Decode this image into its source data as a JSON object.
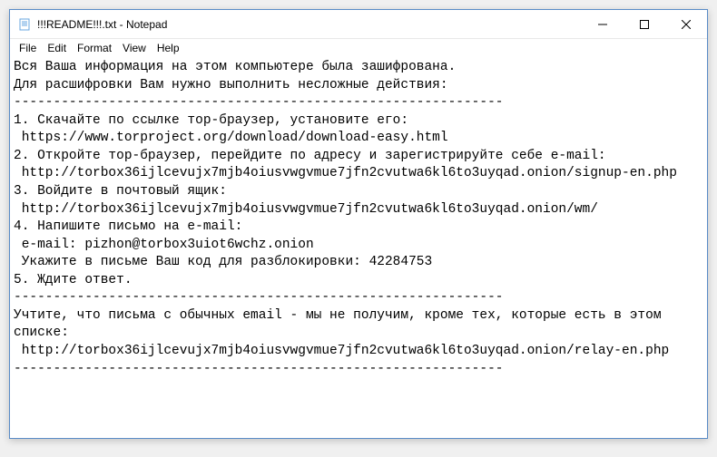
{
  "window": {
    "title": "!!!README!!!.txt - Notepad"
  },
  "menu": {
    "file": "File",
    "edit": "Edit",
    "format": "Format",
    "view": "View",
    "help": "Help"
  },
  "content": {
    "line1": "Вся Ваша информация на этом компьютере была зашифрована.",
    "line2": "Для расшифровки Вам нужно выполнить несложные действия:",
    "sep1": "--------------------------------------------------------------",
    "step1a": "1. Скачайте по ссылке тор-браузер, установите его:",
    "step1b": " https://www.torproject.org/download/download-easy.html",
    "step2a": "2. Откройте тор-браузер, перейдите по адресу и зарегистрируйте себе e-mail:",
    "step2b": " http://torbox36ijlcevujx7mjb4oiusvwgvmue7jfn2cvutwa6kl6to3uyqad.onion/signup-en.php",
    "step3a": "3. Войдите в почтовый ящик:",
    "step3b": " http://torbox36ijlcevujx7mjb4oiusvwgvmue7jfn2cvutwa6kl6to3uyqad.onion/wm/",
    "step4a": "4. Напишите письмо на e-mail:",
    "step4b": " e-mail: pizhon@torbox3uiot6wchz.onion",
    "step4c": " Укажите в письме Ваш код для разблокировки: 42284753",
    "step5": "5. Ждите ответ.",
    "sep2": "--------------------------------------------------------------",
    "note1": "Учтите, что письма с обычных email - мы не получим, кроме тех, которые есть в этом списке:",
    "note2": " http://torbox36ijlcevujx7mjb4oiusvwgvmue7jfn2cvutwa6kl6to3uyqad.onion/relay-en.php",
    "sep3": "--------------------------------------------------------------"
  }
}
